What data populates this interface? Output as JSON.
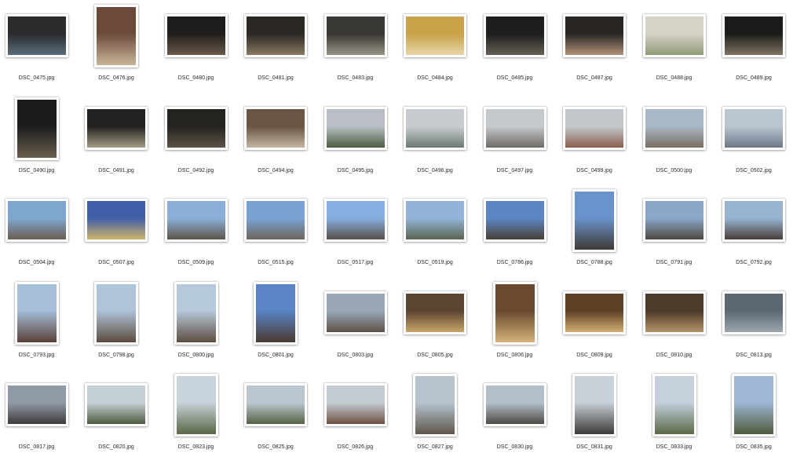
{
  "files": [
    {
      "name": "DSC_0475.jpg",
      "orientation": "landscape",
      "colors": [
        "#2b2b2e",
        "#5a6e7c"
      ]
    },
    {
      "name": "DSC_0476.jpg",
      "orientation": "portrait",
      "colors": [
        "#6b4a3a",
        "#c8b49a"
      ]
    },
    {
      "name": "DSC_0480.jpg",
      "orientation": "landscape",
      "colors": [
        "#1f1d1c",
        "#6b5a4a"
      ]
    },
    {
      "name": "DSC_0481.jpg",
      "orientation": "landscape",
      "colors": [
        "#2c2824",
        "#8a7a62"
      ]
    },
    {
      "name": "DSC_0483.jpg",
      "orientation": "landscape",
      "colors": [
        "#3a3835",
        "#9a9385"
      ]
    },
    {
      "name": "DSC_0484.jpg",
      "orientation": "landscape",
      "colors": [
        "#c9a24a",
        "#e8d6a8"
      ]
    },
    {
      "name": "DSC_0485.jpg",
      "orientation": "landscape",
      "colors": [
        "#1e1e1f",
        "#686056"
      ]
    },
    {
      "name": "DSC_0487.jpg",
      "orientation": "landscape",
      "colors": [
        "#2a2624",
        "#b08f7a"
      ]
    },
    {
      "name": "DSC_0488.jpg",
      "orientation": "landscape",
      "colors": [
        "#d7d2c6",
        "#8e9b76"
      ]
    },
    {
      "name": "DSC_0489.jpg",
      "orientation": "landscape",
      "colors": [
        "#1c1b1a",
        "#807466"
      ]
    },
    {
      "name": "DSC_0490.jpg",
      "orientation": "portrait",
      "colors": [
        "#1b1b1b",
        "#6a5e4c"
      ]
    },
    {
      "name": "DSC_0491.jpg",
      "orientation": "landscape",
      "colors": [
        "#232220",
        "#a59a82"
      ]
    },
    {
      "name": "DSC_0492.jpg",
      "orientation": "landscape",
      "colors": [
        "#252320",
        "#5d5447"
      ]
    },
    {
      "name": "DSC_0494.jpg",
      "orientation": "landscape",
      "colors": [
        "#6a5444",
        "#c4b6a2"
      ]
    },
    {
      "name": "DSC_0495.jpg",
      "orientation": "landscape",
      "colors": [
        "#b9bfc4",
        "#4c5a40"
      ]
    },
    {
      "name": "DSC_0496.jpg",
      "orientation": "landscape",
      "colors": [
        "#c8ccd0",
        "#6b7a70"
      ]
    },
    {
      "name": "DSC_0497.jpg",
      "orientation": "landscape",
      "colors": [
        "#c6c9cc",
        "#6e6a66"
      ]
    },
    {
      "name": "DSC_0499.jpg",
      "orientation": "landscape",
      "colors": [
        "#c3c7cc",
        "#8a5f4e"
      ]
    },
    {
      "name": "DSC_0500.jpg",
      "orientation": "landscape",
      "colors": [
        "#a9b8c6",
        "#7a6d60"
      ]
    },
    {
      "name": "DSC_0502.jpg",
      "orientation": "landscape",
      "colors": [
        "#b9c6d2",
        "#6c7784"
      ]
    },
    {
      "name": "DSC_0504.jpg",
      "orientation": "landscape",
      "colors": [
        "#7fa6cf",
        "#6b5e50"
      ]
    },
    {
      "name": "DSC_0507.jpg",
      "orientation": "landscape",
      "colors": [
        "#3f5fa8",
        "#d0b56a"
      ]
    },
    {
      "name": "DSC_0509.jpg",
      "orientation": "landscape",
      "colors": [
        "#8ab0d9",
        "#5e5448"
      ]
    },
    {
      "name": "DSC_0515.jpg",
      "orientation": "landscape",
      "colors": [
        "#7aa3d4",
        "#6d6458"
      ]
    },
    {
      "name": "DSC_0517.jpg",
      "orientation": "landscape",
      "colors": [
        "#86aee0",
        "#585048"
      ]
    },
    {
      "name": "DSC_0519.jpg",
      "orientation": "landscape",
      "colors": [
        "#93b4d8",
        "#5b6450"
      ]
    },
    {
      "name": "DSC_0786.jpg",
      "orientation": "landscape",
      "colors": [
        "#5d86c4",
        "#4a3e36"
      ]
    },
    {
      "name": "DSC_0788.jpg",
      "orientation": "portrait",
      "colors": [
        "#6a93cc",
        "#3e3a36"
      ]
    },
    {
      "name": "DSC_0791.jpg",
      "orientation": "landscape",
      "colors": [
        "#8aa7c9",
        "#4f4640"
      ]
    },
    {
      "name": "DSC_0792.jpg",
      "orientation": "landscape",
      "colors": [
        "#98b4d0",
        "#4a3d38"
      ]
    },
    {
      "name": "DSC_0793.jpg",
      "orientation": "portrait",
      "colors": [
        "#a5bfd8",
        "#5a4038"
      ]
    },
    {
      "name": "DSC_0798.jpg",
      "orientation": "portrait",
      "colors": [
        "#aec4d9",
        "#5c4a3e"
      ]
    },
    {
      "name": "DSC_0800.jpg",
      "orientation": "portrait",
      "colors": [
        "#b6c9db",
        "#5e4d40"
      ]
    },
    {
      "name": "DSC_0801.jpg",
      "orientation": "portrait",
      "colors": [
        "#5a84c6",
        "#4a3a30"
      ]
    },
    {
      "name": "DSC_0803.jpg",
      "orientation": "landscape",
      "colors": [
        "#9aa8b5",
        "#5c5048"
      ]
    },
    {
      "name": "DSC_0805.jpg",
      "orientation": "landscape",
      "colors": [
        "#5c4530",
        "#c9a56a"
      ]
    },
    {
      "name": "DSC_0806.jpg",
      "orientation": "portrait",
      "colors": [
        "#6a4a2e",
        "#d6b27a"
      ]
    },
    {
      "name": "DSC_0809.jpg",
      "orientation": "landscape",
      "colors": [
        "#5e4026",
        "#d4ae76"
      ]
    },
    {
      "name": "DSC_0810.jpg",
      "orientation": "landscape",
      "colors": [
        "#4c3a2a",
        "#b6946a"
      ]
    },
    {
      "name": "DSC_0813.jpg",
      "orientation": "landscape",
      "colors": [
        "#5d6770",
        "#9ba6ae"
      ]
    },
    {
      "name": "DSC_0817.jpg",
      "orientation": "landscape",
      "colors": [
        "#8e9aa6",
        "#3e3a38"
      ]
    },
    {
      "name": "DSC_0820.jpg",
      "orientation": "landscape",
      "colors": [
        "#c5cfd6",
        "#4d5a3e"
      ]
    },
    {
      "name": "DSC_0823.jpg",
      "orientation": "portrait",
      "colors": [
        "#c9d3db",
        "#5a6646"
      ]
    },
    {
      "name": "DSC_0825.jpg",
      "orientation": "landscape",
      "colors": [
        "#bac6cf",
        "#566144"
      ]
    },
    {
      "name": "DSC_0826.jpg",
      "orientation": "landscape",
      "colors": [
        "#c3cbd1",
        "#6e4e44"
      ]
    },
    {
      "name": "DSC_0827.jpg",
      "orientation": "portrait",
      "colors": [
        "#b7c4d0",
        "#5f564c"
      ]
    },
    {
      "name": "DSC_0830.jpg",
      "orientation": "landscape",
      "colors": [
        "#b2bfcb",
        "#4e4a44"
      ]
    },
    {
      "name": "DSC_0831.jpg",
      "orientation": "portrait",
      "colors": [
        "#c8d0d8",
        "#3c3a38"
      ]
    },
    {
      "name": "DSC_0833.jpg",
      "orientation": "portrait",
      "colors": [
        "#c4d0dc",
        "#5a6a46"
      ]
    },
    {
      "name": "DSC_0835.jpg",
      "orientation": "portrait",
      "colors": [
        "#9fb7d4",
        "#4e5a3c"
      ]
    }
  ]
}
